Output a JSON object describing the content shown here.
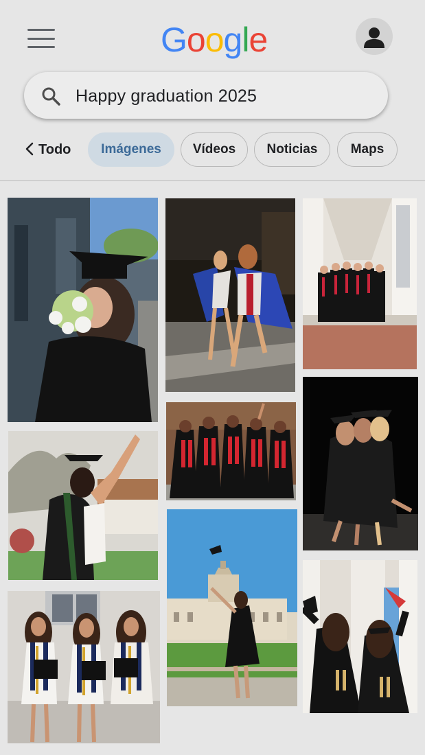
{
  "header": {
    "logo_text": "Google",
    "menu_icon": "hamburger-menu-icon",
    "avatar_icon": "account-icon"
  },
  "search": {
    "query": "Happy graduation 2025",
    "icon": "search-icon"
  },
  "filters": {
    "back_label": "Todo",
    "chips": [
      {
        "label": "Imágenes",
        "active": true
      },
      {
        "label": "Vídeos",
        "active": false
      },
      {
        "label": "Noticias",
        "active": false
      },
      {
        "label": "Maps",
        "active": false
      }
    ]
  },
  "results": {
    "images": [
      {
        "description": "Graduate in cap holding white flower bouquet"
      },
      {
        "description": "Two graduates running in blue gowns"
      },
      {
        "description": "Group of graduates under colonnade"
      },
      {
        "description": "Graduate in cap and gown raising arm"
      },
      {
        "description": "Group of graduates with red stoles"
      },
      {
        "description": "Three graduates hugging at night"
      },
      {
        "description": "Three graduates with blue and gold stoles"
      },
      {
        "description": "Graduate tossing cap in front of capitol building"
      },
      {
        "description": "Two graduates from behind holding caps"
      }
    ]
  },
  "colors": {
    "google_blue": "#4285F4",
    "google_red": "#EA4335",
    "google_yellow": "#FBBC05",
    "google_green": "#34A853",
    "active_chip_bg": "#cfdae3",
    "active_chip_text": "#3c6a98"
  }
}
